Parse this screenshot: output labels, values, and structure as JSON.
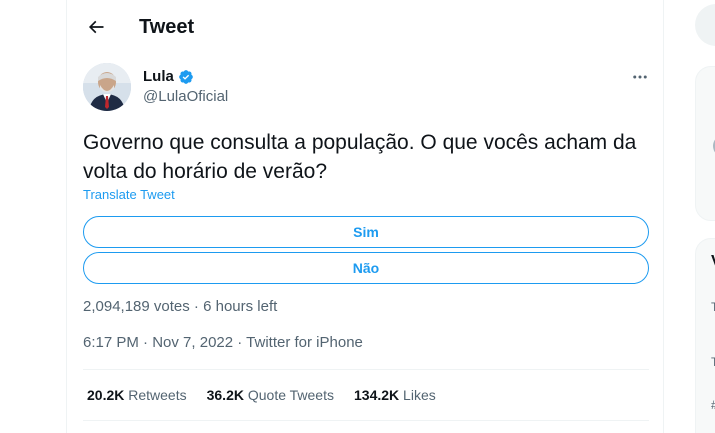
{
  "header": {
    "title": "Tweet"
  },
  "tweet": {
    "display_name": "Lula",
    "handle": "@LulaOficial",
    "text": "Governo que consulta a população. O que vocês acham da volta do horário de verão?",
    "translate_label": "Translate Tweet",
    "poll": {
      "options": [
        "Sim",
        "Não"
      ],
      "votes": "2,094,189 votes",
      "separator": " · ",
      "time_left": "6 hours left"
    },
    "time": "6:17 PM",
    "date": "Nov 7, 2022",
    "source": "Twitter for iPhone",
    "stats": {
      "retweets_count": "20.2K",
      "retweets_label": "Retweets",
      "quotes_count": "36.2K",
      "quotes_label": "Quote Tweets",
      "likes_count": "134.2K",
      "likes_label": "Likes"
    }
  },
  "sidebar_fragments": {
    "frag1": "V",
    "frag2": "T",
    "frag3": "T",
    "frag4": "#"
  },
  "icons": {
    "back": "arrow-left-icon",
    "verified": "verified-badge-icon",
    "more": "more-horizontal-icon"
  },
  "colors": {
    "accent": "#1d9bf0",
    "text_primary": "#0f1419",
    "text_secondary": "#536471",
    "border": "#eff3f4"
  }
}
